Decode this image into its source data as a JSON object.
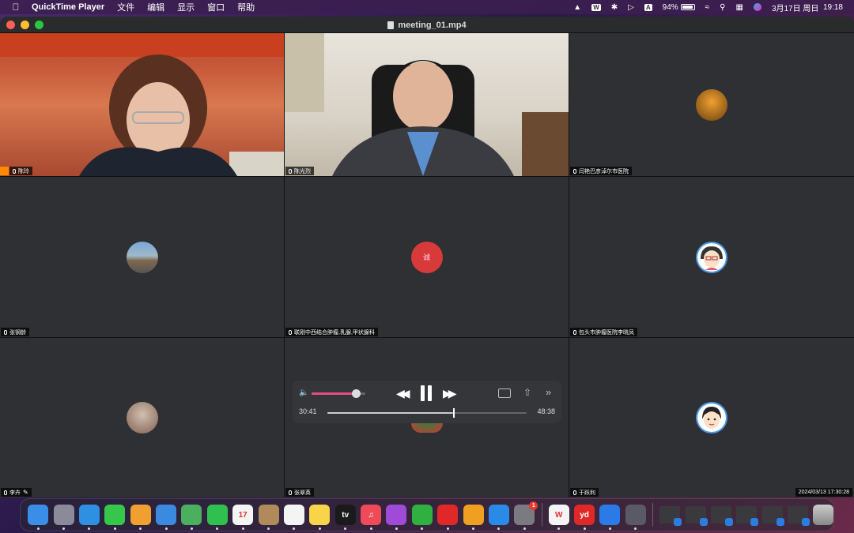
{
  "menubar": {
    "app_name": "QuickTime Player",
    "menus": [
      "文件",
      "编辑",
      "显示",
      "窗口",
      "帮助"
    ],
    "battery": "94%",
    "battery_level": 0.94,
    "date": "3月17日 周日",
    "time": "19:18",
    "status_icons": [
      "meet-icon",
      "wps-icon",
      "bluetooth-icon",
      "play-circle-icon",
      "font-a-icon",
      "battery-icon",
      "wifi-icon",
      "search-icon",
      "control-center-icon",
      "siri-icon"
    ]
  },
  "window": {
    "title": "meeting_01.mp4"
  },
  "tiles": [
    {
      "name": "陈玲",
      "type": "video-woman",
      "host": true
    },
    {
      "name": "陈光烈",
      "type": "video-man",
      "active": true
    },
    {
      "name": "闫艳巴彦淖尔市医院",
      "type": "avatar",
      "avatar_color": "#8a5a20"
    },
    {
      "name": "张钢龄",
      "type": "avatar",
      "avatar_color": "#6a8ab0"
    },
    {
      "name": "联刚中西结合肿瘤,乳腺,甲状腺科",
      "type": "avatar",
      "avatar_color": "#d83a3a",
      "avatar_text": "诚"
    },
    {
      "name": "包头市肿瘤医院李晓凤",
      "type": "avatar",
      "avatar_color": "#3a8ad8"
    },
    {
      "name": "李卉",
      "type": "avatar",
      "avatar_color": "#a89080",
      "editing": true
    },
    {
      "name": "张翠英",
      "type": "blank"
    },
    {
      "name": "于跃利",
      "type": "avatar",
      "avatar_color": "#4a9ae8",
      "timestamp": "2024/03/13 17:30:28"
    }
  ],
  "player": {
    "current_time": "30:41",
    "total_time": "48:38",
    "progress": 0.631,
    "volume": 0.82
  },
  "dock": {
    "apps": [
      {
        "name": "finder-icon",
        "color": "#3b8ee8",
        "label": ""
      },
      {
        "name": "launchpad-icon",
        "color": "#8a8a9a",
        "label": ""
      },
      {
        "name": "safari-icon",
        "color": "#2f8fe0",
        "label": ""
      },
      {
        "name": "messages-icon",
        "color": "#36c64a",
        "label": ""
      },
      {
        "name": "photos-icon",
        "color": "#f0a030",
        "label": ""
      },
      {
        "name": "mail-icon",
        "color": "#3a8ae0",
        "label": ""
      },
      {
        "name": "maps-icon",
        "color": "#4ab060",
        "label": ""
      },
      {
        "name": "facetime-icon",
        "color": "#30c050",
        "label": ""
      },
      {
        "name": "calendar-icon",
        "color": "#f4f4f4",
        "label": "17"
      },
      {
        "name": "contacts-icon",
        "color": "#b08a5a",
        "label": ""
      },
      {
        "name": "reminders-icon",
        "color": "#f4f4f4",
        "label": ""
      },
      {
        "name": "notes-icon",
        "color": "#f8d44a",
        "label": ""
      },
      {
        "name": "apple-tv-icon",
        "color": "#1a1a1a",
        "label": "tv"
      },
      {
        "name": "music-icon",
        "color": "#f04a5a",
        "label": "♫"
      },
      {
        "name": "podcasts-icon",
        "color": "#a04ad8",
        "label": ""
      },
      {
        "name": "numbers-icon",
        "color": "#30b040",
        "label": ""
      },
      {
        "name": "netease-music-icon",
        "color": "#e02828",
        "label": ""
      },
      {
        "name": "pages-icon",
        "color": "#f0a020",
        "label": ""
      },
      {
        "name": "app-store-icon",
        "color": "#2a8ae8",
        "label": ""
      },
      {
        "name": "system-settings-icon",
        "color": "#7a7a80",
        "label": "",
        "badge": "1"
      }
    ],
    "apps2": [
      {
        "name": "wps-icon",
        "color": "#f4f4f4",
        "label": "W"
      },
      {
        "name": "youdao-icon",
        "color": "#e02828",
        "label": "yd"
      },
      {
        "name": "tencent-meeting-icon",
        "color": "#2a7ae8",
        "label": ""
      },
      {
        "name": "quicktime-icon",
        "color": "#5a5a66",
        "label": ""
      }
    ],
    "thumbs": 6,
    "trash": "trash-icon"
  }
}
